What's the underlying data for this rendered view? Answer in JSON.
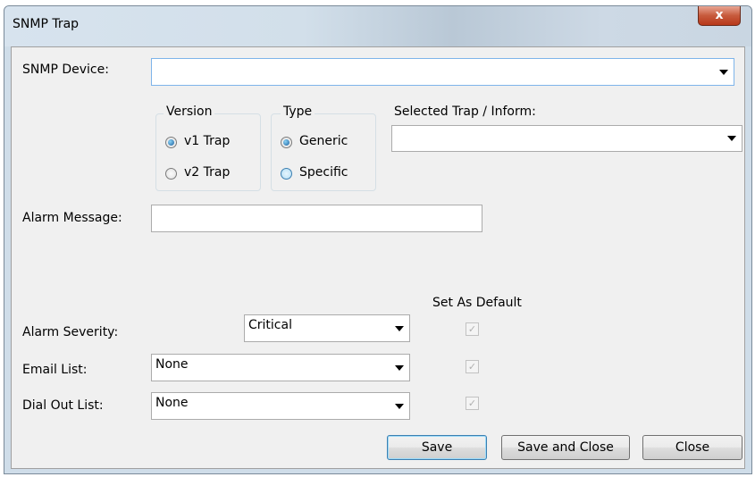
{
  "window": {
    "title": "SNMP Trap",
    "close_glyph": "x"
  },
  "snmp_device": {
    "label": "SNMP Device:",
    "value": ""
  },
  "version_group": {
    "title": "Version",
    "options": [
      {
        "label": "v1 Trap",
        "checked": true
      },
      {
        "label": "v2 Trap",
        "checked": false
      }
    ]
  },
  "type_group": {
    "title": "Type",
    "options": [
      {
        "label": "Generic",
        "checked": true
      },
      {
        "label": "Specific",
        "checked": false
      }
    ]
  },
  "selected_trap": {
    "label": "Selected Trap / Inform:",
    "value": ""
  },
  "alarm_message": {
    "label": "Alarm Message:",
    "value": ""
  },
  "set_as_default_label": "Set As Default",
  "alarm_severity": {
    "label": "Alarm Severity:",
    "value": "Critical",
    "default_checked": true
  },
  "email_list": {
    "label": "Email List:",
    "value": "None",
    "default_checked": true
  },
  "dial_out_list": {
    "label": "Dial Out List:",
    "value": "None",
    "default_checked": true
  },
  "buttons": {
    "save": "Save",
    "save_and_close": "Save and Close",
    "close": "Close"
  }
}
